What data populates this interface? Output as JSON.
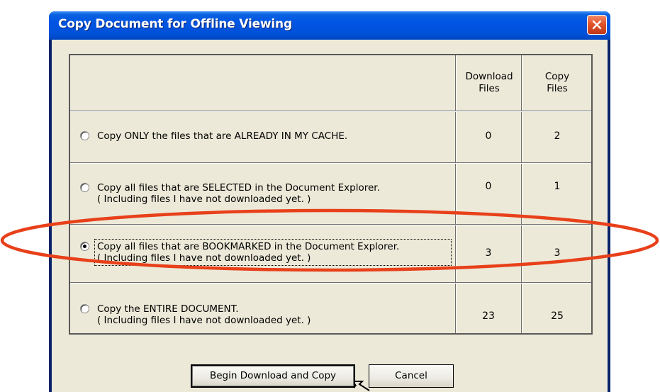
{
  "dialog": {
    "title": "Copy Document for Offline Viewing"
  },
  "table": {
    "headers": {
      "download": "Download\nFiles",
      "copy": "Copy\nFiles"
    },
    "rows": [
      {
        "line1": "Copy ONLY the files that are ALREADY IN MY CACHE.",
        "line2": "",
        "download": "0",
        "copy": "2",
        "selected": false
      },
      {
        "line1": "Copy all files that are SELECTED in the Document Explorer.",
        "line2": "( Including files I have not downloaded yet. )",
        "download": "0",
        "copy": "1",
        "selected": false
      },
      {
        "line1": "Copy all files that are BOOKMARKED in the Document Explorer.",
        "line2": "( Including files I have not downloaded yet. )",
        "download": "3",
        "copy": "3",
        "selected": true
      },
      {
        "line1": "Copy the ENTIRE DOCUMENT.",
        "line2": "( Including files I have not downloaded yet. )",
        "download": "23",
        "copy": "25",
        "selected": false
      }
    ]
  },
  "buttons": {
    "begin": "Begin Download and Copy",
    "cancel": "Cancel"
  },
  "colors": {
    "titlebar": "#0054E3",
    "dialog_bg": "#ECE9D8",
    "annotation": "#E8401A"
  }
}
